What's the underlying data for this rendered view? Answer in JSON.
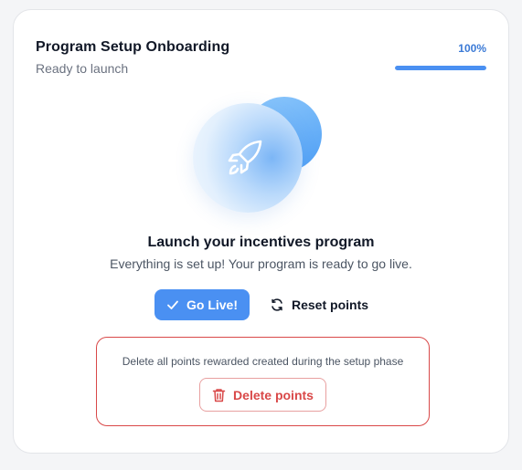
{
  "header": {
    "title": "Program Setup Onboarding",
    "subtitle": "Ready to launch",
    "progress_label": "100%",
    "progress_fraction": 1.0
  },
  "hero": {
    "icon": "rocket-icon"
  },
  "content": {
    "headline": "Launch your incentives program",
    "description": "Everything is set up! Your program is ready to go live."
  },
  "actions": {
    "go_live_label": "Go Live!",
    "go_live_icon": "check-icon",
    "reset_label": "Reset points",
    "reset_icon": "refresh-icon"
  },
  "danger_zone": {
    "text": "Delete all points rewarded created during the setup phase",
    "delete_label": "Delete points",
    "delete_icon": "trash-icon"
  },
  "colors": {
    "accent": "#4a90f2",
    "danger": "#d94848"
  }
}
